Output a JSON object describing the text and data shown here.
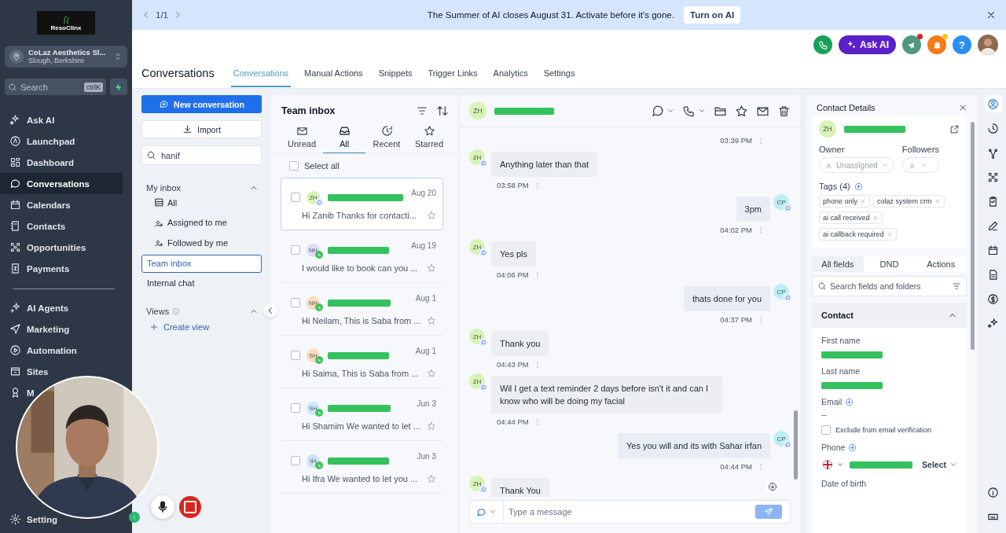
{
  "sidebar": {
    "logo": "ResoClinx",
    "account": {
      "name": "CoLaz Aesthetics Sl...",
      "location": "Slough, Berkshire"
    },
    "search": {
      "placeholder": "Search",
      "shortcut": "ctrlK"
    },
    "items": [
      {
        "label": "Ask AI",
        "selected": false
      },
      {
        "label": "Launchpad",
        "selected": false
      },
      {
        "label": "Dashboard",
        "selected": false
      },
      {
        "label": "Conversations",
        "selected": true
      },
      {
        "label": "Calendars",
        "selected": false
      },
      {
        "label": "Contacts",
        "selected": false
      },
      {
        "label": "Opportunities",
        "selected": false
      },
      {
        "label": "Payments",
        "selected": false
      }
    ],
    "items2": [
      {
        "label": "AI Agents",
        "selected": false
      },
      {
        "label": "Marketing",
        "selected": false
      },
      {
        "label": "Automation",
        "selected": false
      },
      {
        "label": "Sites",
        "selected": false
      },
      {
        "label": "M",
        "selected": false
      }
    ],
    "settings": "Setting"
  },
  "banner": {
    "pager": "1/1",
    "message": "The Summer of AI closes August 31. Activate before it's gone.",
    "button": "Turn on AI"
  },
  "topbar": {
    "ask_ai": "Ask AI",
    "help": "?",
    "megaphone_badge": true,
    "bell_badge": true
  },
  "header": {
    "title": "Conversations",
    "tabs": [
      {
        "label": "Conversations",
        "selected": true
      },
      {
        "label": "Manual Actions",
        "selected": false
      },
      {
        "label": "Snippets",
        "selected": false
      },
      {
        "label": "Trigger Links",
        "selected": false
      },
      {
        "label": "Analytics",
        "selected": false
      },
      {
        "label": "Settings",
        "selected": false
      }
    ]
  },
  "left_nav": {
    "new_conversation": "New conversation",
    "import": "Import",
    "search_value": "hanif",
    "my_inbox": {
      "title": "My inbox",
      "expanded": true,
      "items": [
        {
          "label": "All"
        },
        {
          "label": "Assigned to me"
        },
        {
          "label": "Followed by me"
        }
      ]
    },
    "inboxes": [
      {
        "label": "Team inbox",
        "selected": true
      },
      {
        "label": "Internal chat",
        "selected": false
      }
    ],
    "views": {
      "title": "Views",
      "expanded": true,
      "create": "Create view"
    }
  },
  "inbox": {
    "title": "Team inbox",
    "filters": [
      {
        "label": "Unread",
        "selected": false
      },
      {
        "label": "All",
        "selected": true
      },
      {
        "label": "Recent",
        "selected": false
      },
      {
        "label": "Starred",
        "selected": false
      }
    ],
    "select_all": "Select all",
    "select_all_checked": false,
    "conversations": [
      {
        "initials": "ZH",
        "color": "#d8f3b4",
        "kind": "sms",
        "checked": false,
        "date": "Aug 20",
        "preview": "Hi Zanib Thanks for contacti...",
        "selected": true,
        "redacted": true
      },
      {
        "initials": "NH",
        "color": "#e3dcf6",
        "kind": "whatsapp",
        "checked": false,
        "date": "Aug 19",
        "preview": "I would like to book can you ...",
        "selected": false,
        "redacted": true
      },
      {
        "initials": "NH",
        "color": "#fcdcbc",
        "kind": "whatsapp",
        "checked": false,
        "date": "Aug 1",
        "preview": "Hi Neilam, This is Saba from ...",
        "selected": false,
        "redacted": true
      },
      {
        "initials": "SH",
        "color": "#fcdcbc",
        "kind": "whatsapp",
        "checked": false,
        "date": "Aug 1",
        "preview": "Hi Saima, This is Saba from ...",
        "selected": false,
        "redacted": true
      },
      {
        "initials": "SH",
        "color": "#cde8fa",
        "kind": "whatsapp",
        "checked": false,
        "date": "Jun 3",
        "preview": "Hi Shamim We wanted to let ...",
        "selected": false,
        "redacted": true
      },
      {
        "initials": "IH",
        "color": "#cfe0f6",
        "kind": "whatsapp",
        "checked": false,
        "date": "Jun 3",
        "preview": "Hi Ifra We wanted to let you ...",
        "selected": false,
        "redacted": true
      }
    ]
  },
  "chat": {
    "initials": "ZH",
    "redacted": true,
    "messages": [
      {
        "outgoing": true,
        "time": "03:39 PM"
      },
      {
        "outgoing": false,
        "initials": "ZH",
        "text": "Anything later than that",
        "time": "03:58 PM"
      },
      {
        "outgoing": true,
        "initials": "CP",
        "text": "3pm",
        "time": "04:02 PM"
      },
      {
        "outgoing": false,
        "initials": "ZH",
        "text": "Yes pls",
        "time": "04:06 PM"
      },
      {
        "outgoing": true,
        "initials": "CP",
        "text": "thats done for you",
        "time": "04:37 PM"
      },
      {
        "outgoing": false,
        "initials": "ZH",
        "text": "Thank you",
        "time": "04:43 PM"
      },
      {
        "outgoing": false,
        "initials": "ZH",
        "text": "Wil I get a text reminder 2 days before isn't it and can I know who will be doing my facial",
        "time": "04:44 PM"
      },
      {
        "outgoing": true,
        "initials": "CP",
        "text": "Yes you will and its with Sahar irfan",
        "time": "04:44 PM"
      },
      {
        "outgoing": false,
        "initials": "ZH",
        "text": "Thank You"
      }
    ],
    "composer": {
      "placeholder": "Type a message"
    }
  },
  "contact": {
    "title": "Contact Details",
    "initials": "ZH",
    "redacted": true,
    "owner_label": "Owner",
    "owner": "Unassigned",
    "followers_label": "Followers",
    "tags_label": "Tags (4)",
    "tags": [
      "phone only",
      "colaz system crm",
      "ai call received",
      "ai callback required"
    ],
    "tabs": [
      {
        "label": "All fields",
        "selected": true
      },
      {
        "label": "DND",
        "selected": false
      },
      {
        "label": "Actions",
        "selected": false
      }
    ],
    "search_placeholder": "Search fields and folders",
    "section": {
      "title": "Contact",
      "expanded": true
    },
    "fields": [
      {
        "kind": "redacted",
        "label": "First name"
      },
      {
        "kind": "redacted",
        "label": "Last name"
      },
      {
        "kind": "email",
        "label": "Email",
        "value": "--",
        "exclude_label": "Exclude from email verification",
        "exclude_checked": false
      },
      {
        "kind": "phone",
        "label": "Phone",
        "select": "Select"
      },
      {
        "kind": "label",
        "label": "Date of birth"
      }
    ]
  }
}
